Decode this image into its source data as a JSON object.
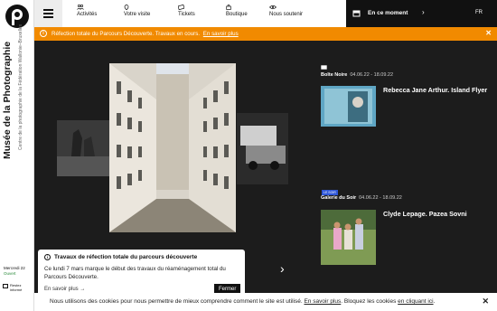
{
  "museum": {
    "title": "Musée de la Photographie",
    "subtitle": "Centre de la photographie de la Fédération Wallonie–Bruxelles",
    "day": "Mercredi 22",
    "status": "Ouvert",
    "newsletter": [
      "Restez",
      "informé"
    ]
  },
  "nav": {
    "items": [
      {
        "label": "Activités",
        "icon": "people-icon"
      },
      {
        "label": "Votre visite",
        "icon": "pin-icon"
      },
      {
        "label": "Tickets",
        "icon": "ticket-icon"
      },
      {
        "label": "Boutique",
        "icon": "bag-icon"
      },
      {
        "label": "Nous soutenir",
        "icon": "eye-icon"
      }
    ],
    "encours": "En ce moment",
    "lang": "FR"
  },
  "alert": {
    "text": "Réfection totale du Parcours Découverte. Travaux en cours.",
    "link": "En savoir plus",
    "color": "#f18a00"
  },
  "events": [
    {
      "tag": "Boîte Noire",
      "dates": "04.06.22 - 18.09.22",
      "title": "Rebecca Jane Arthur. Island Flyer"
    },
    {
      "badge": "LE SOIR",
      "tag": "Galerie du Soir",
      "dates": "04.06.22 - 18.09.22",
      "title": "Clyde Lepage. Pazea Sovni"
    }
  ],
  "popup": {
    "title": "Travaux de réfection totale du parcours découverte",
    "body": "Ce lundi 7 mars marque le début des travaux du réaménagement total du Parcours Découverte.",
    "more": "En savoir plus",
    "close": "Fermer"
  },
  "cookie": {
    "text1": "Nous utilisons des cookies pour nous permettre de mieux comprendre comment le site est utilisé.",
    "link1": "En savoir plus",
    "text2": ". Bloquez les cookies",
    "link2": "en cliquant ici",
    "text3": "."
  }
}
